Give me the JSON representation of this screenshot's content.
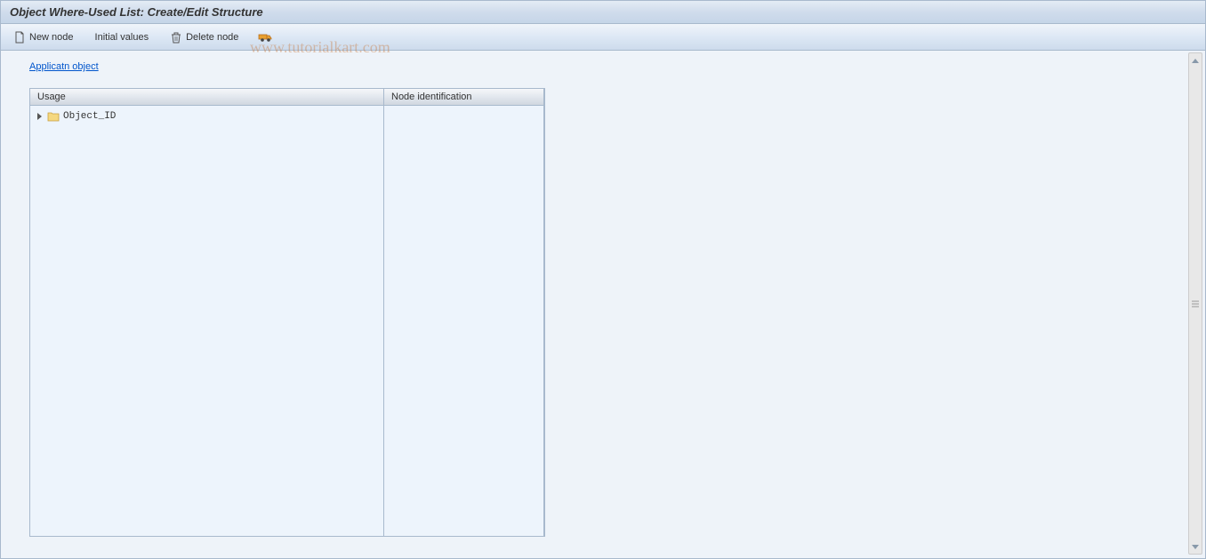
{
  "title": "Object Where-Used List: Create/Edit Structure",
  "toolbar": {
    "new_node": "New node",
    "initial_values": "Initial values",
    "delete_node": "Delete node"
  },
  "link": {
    "application_object": "Applicatn object"
  },
  "tree": {
    "headers": {
      "usage": "Usage",
      "node_identification": "Node identification"
    },
    "items": [
      {
        "label": "Object_ID"
      }
    ]
  },
  "watermark": "www.tutorialkart.com"
}
